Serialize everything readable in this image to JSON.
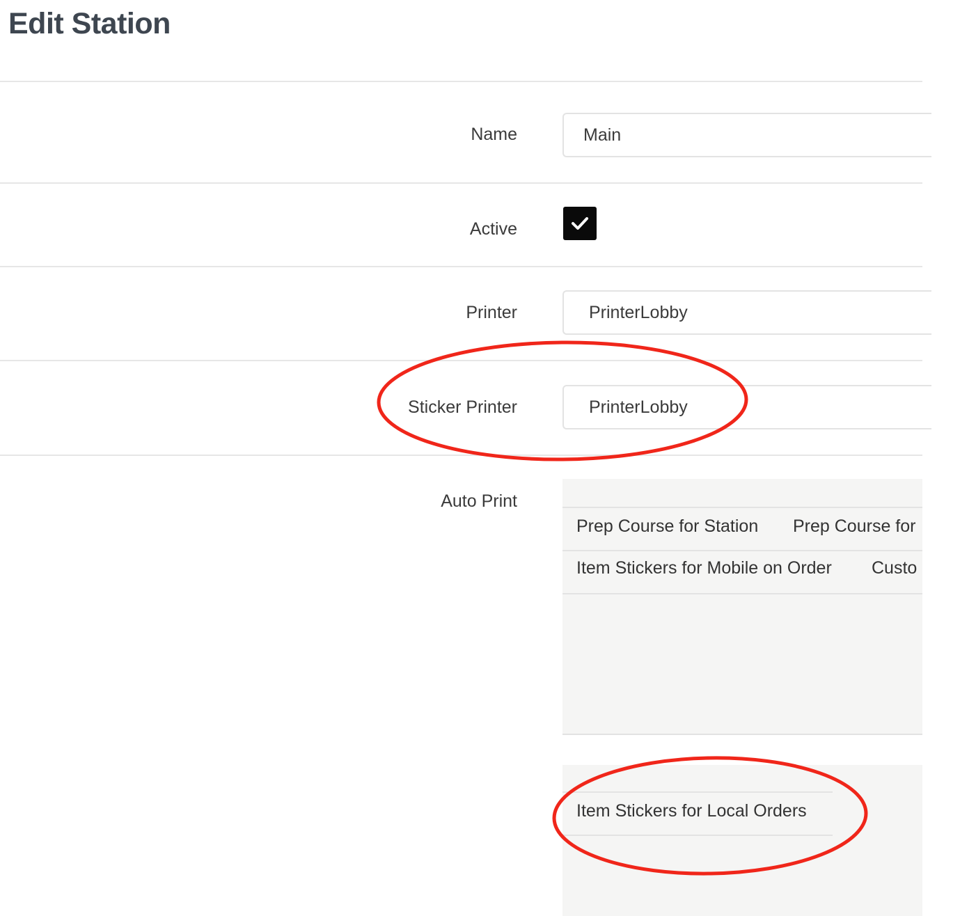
{
  "header": {
    "title": "Edit Station"
  },
  "form": {
    "name": {
      "label": "Name",
      "value": "Main"
    },
    "active": {
      "label": "Active",
      "checked": true
    },
    "printer": {
      "label": "Printer",
      "value": "PrinterLobby"
    },
    "sticker_printer": {
      "label": "Sticker Printer",
      "value": "PrinterLobby"
    },
    "auto_print": {
      "label": "Auto Print",
      "selected_rows": [
        [
          "Prep Course for Station",
          "Prep Course for"
        ],
        [
          "Item Stickers for Mobile on Order",
          "Custo"
        ]
      ],
      "available_items": [
        "Item Stickers for Local Orders"
      ]
    }
  },
  "colors": {
    "annotation_red": "#f0261a",
    "checkbox_fill": "#0a0a0a",
    "list_background": "#f5f5f4",
    "title_text": "#3e4650"
  }
}
